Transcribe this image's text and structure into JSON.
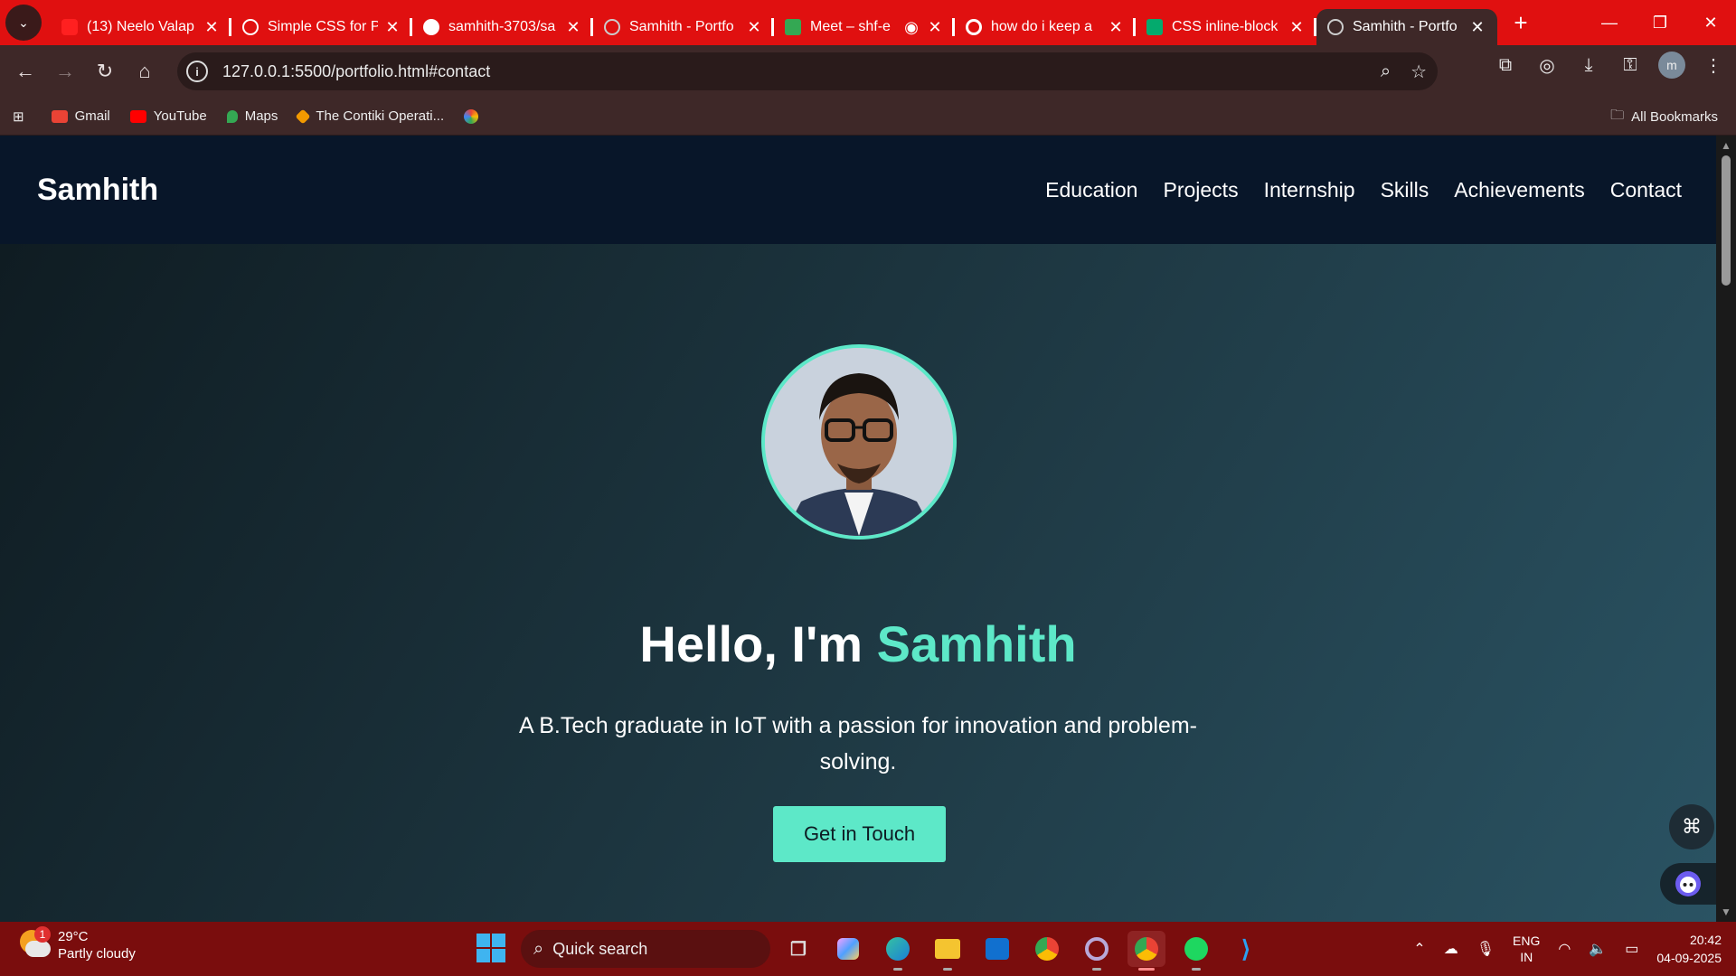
{
  "browser": {
    "tabs": [
      {
        "title": "(13) Neelo Valap",
        "favicon": "youtube-icon",
        "color": "#ff2020"
      },
      {
        "title": "Simple CSS for P",
        "favicon": "chatgpt-icon",
        "color": "#ffffff"
      },
      {
        "title": "samhith-3703/sa",
        "favicon": "github-icon",
        "color": "#ffffff"
      },
      {
        "title": "Samhith - Portfo",
        "favicon": "globe-icon",
        "color": "#cccccc"
      },
      {
        "title": "Meet – shf-e",
        "favicon": "meet-icon",
        "color": "#34a853"
      },
      {
        "title": "how do i keep a",
        "favicon": "google-icon",
        "color": "#ffffff"
      },
      {
        "title": "CSS inline-block",
        "favicon": "w3schools-icon",
        "color": "#04aa6d"
      },
      {
        "title": "Samhith - Portfo",
        "favicon": "globe-icon",
        "color": "#cccccc",
        "active": true
      }
    ],
    "url": "127.0.0.1:5500/portfolio.html#contact",
    "profile_initial": "m",
    "bookmarks": [
      {
        "label": "Gmail",
        "icon": "gmail-icon",
        "color": "#ea4335"
      },
      {
        "label": "YouTube",
        "icon": "youtube-icon",
        "color": "#ff0000"
      },
      {
        "label": "Maps",
        "icon": "maps-icon",
        "color": "#34a853"
      },
      {
        "label": "The Contiki Operati...",
        "icon": "contiki-icon",
        "color": "#f29900"
      }
    ],
    "all_bookmarks": "All Bookmarks"
  },
  "site": {
    "brand": "Samhith",
    "nav": [
      "Education",
      "Projects",
      "Internship",
      "Skills",
      "Achievements",
      "Contact"
    ],
    "hero": {
      "greeting": "Hello, I'm ",
      "name": "Samhith",
      "tagline": "A B.Tech graduate in IoT with a passion for innovation and problem-solving.",
      "cta": "Get in Touch"
    },
    "accent": "#5de8c8",
    "nav_bg": "#081629"
  },
  "taskbar": {
    "weather_badge": "1",
    "temperature": "29°C",
    "condition": "Partly cloudy",
    "search_placeholder": "Quick search",
    "lang_line1": "ENG",
    "lang_line2": "IN",
    "time": "20:42",
    "date": "04-09-2025"
  }
}
